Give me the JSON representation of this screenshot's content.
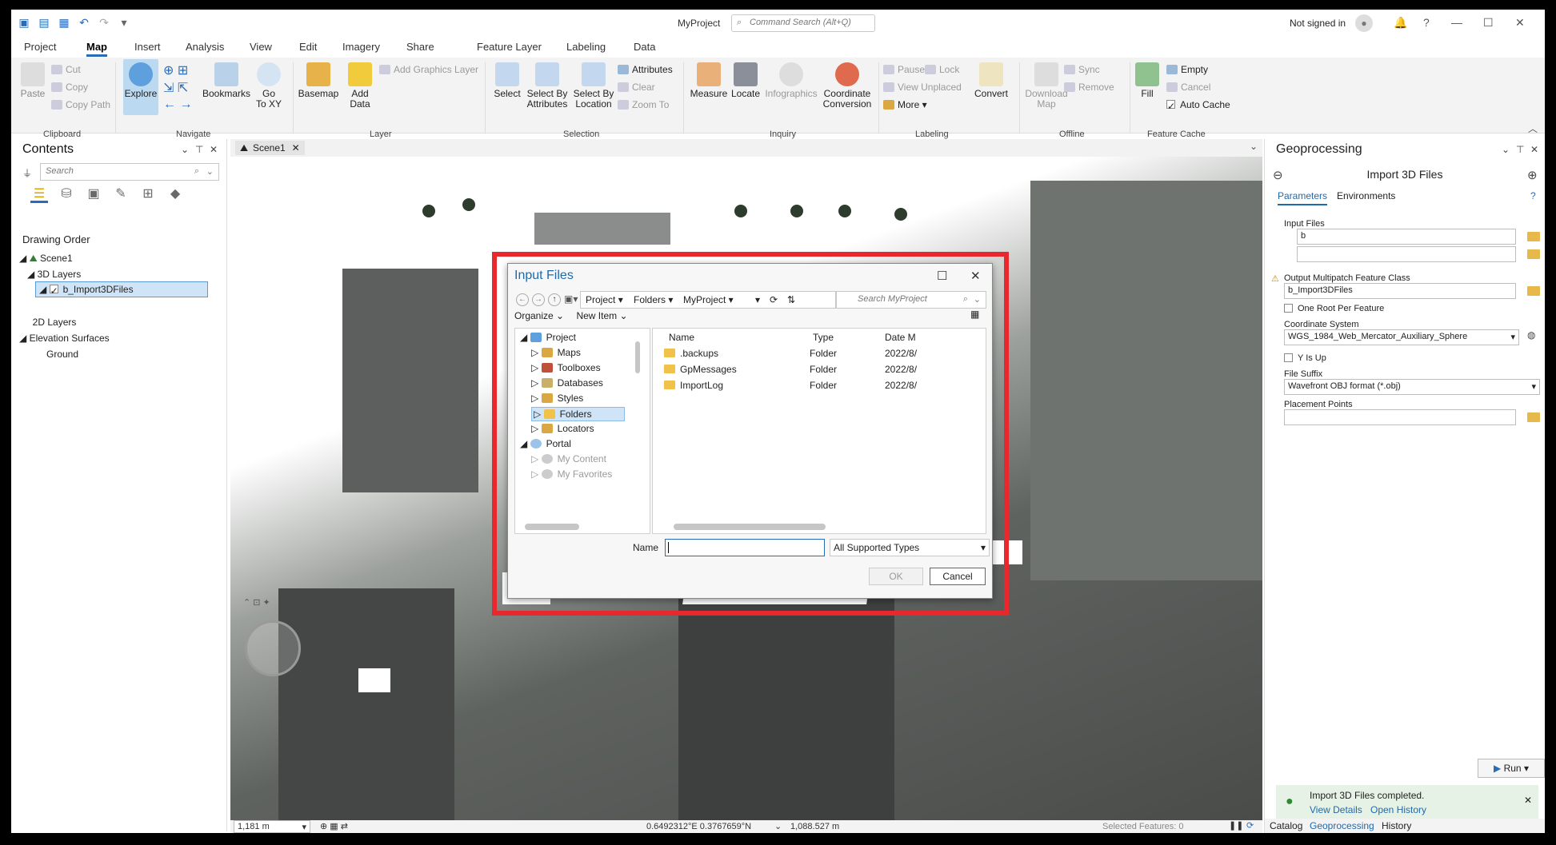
{
  "app": {
    "title": "MyProject",
    "command_search": "Command Search (Alt+Q)",
    "signin": "Not signed in"
  },
  "tabs": [
    "Project",
    "Map",
    "Insert",
    "Analysis",
    "View",
    "Edit",
    "Imagery",
    "Share",
    "Feature Layer",
    "Labeling",
    "Data"
  ],
  "ribbon": {
    "paste": "Paste",
    "cut": "Cut",
    "copy": "Copy",
    "copy_path": "Copy Path",
    "clipboard": "Clipboard",
    "explore": "Explore",
    "bookmarks": "Bookmarks",
    "goto_xy_1": "Go",
    "goto_xy_2": "To XY",
    "navigate": "Navigate",
    "basemap": "Basemap",
    "add_data_1": "Add",
    "add_data_2": "Data",
    "add_graphics": "Add Graphics Layer",
    "layer": "Layer",
    "select": "Select",
    "sel_attr_1": "Select By",
    "sel_attr_2": "Attributes",
    "sel_loc_1": "Select By",
    "sel_loc_2": "Location",
    "attributes": "Attributes",
    "clear": "Clear",
    "zoom_to": "Zoom To",
    "selection": "Selection",
    "measure": "Measure",
    "locate": "Locate",
    "infographics": "Infographics",
    "coord_1": "Coordinate",
    "coord_2": "Conversion",
    "inquiry": "Inquiry",
    "pause": "Pause",
    "lock": "Lock",
    "view_unplaced": "View Unplaced",
    "more": "More",
    "convert": "Convert",
    "labeling": "Labeling",
    "download_1": "Download",
    "download_2": "Map",
    "sync": "Sync",
    "remove": "Remove",
    "offline": "Offline",
    "fill": "Fill",
    "empty": "Empty",
    "cancel": "Cancel",
    "auto_cache": "Auto Cache",
    "feature_cache": "Feature Cache"
  },
  "contents": {
    "title": "Contents",
    "search_placeholder": "Search",
    "drawing_order": "Drawing Order",
    "scene": "Scene1",
    "layers3d": "3D Layers",
    "layer": "b_Import3DFiles",
    "layers2d": "2D Layers",
    "elevation": "Elevation Surfaces",
    "ground": "Ground"
  },
  "view": {
    "tab": "Scene1",
    "scale": "1,181 m",
    "coords": "0.6492312°E 0.3767659°N",
    "elev": "1,088.527 m",
    "selected": "Selected Features: 0"
  },
  "dialog": {
    "title": "Input Files",
    "crumbs": [
      "Project",
      "Folders",
      "MyProject"
    ],
    "search_placeholder": "Search MyProject",
    "organize": "Organize",
    "new_item": "New Item",
    "nav": [
      {
        "label": "Project",
        "level": 0
      },
      {
        "label": "Maps",
        "level": 1
      },
      {
        "label": "Toolboxes",
        "level": 1
      },
      {
        "label": "Databases",
        "level": 1
      },
      {
        "label": "Styles",
        "level": 1
      },
      {
        "label": "Folders",
        "level": 1
      },
      {
        "label": "Locators",
        "level": 1
      },
      {
        "label": "Portal",
        "level": 0
      },
      {
        "label": "My Content",
        "level": 1
      },
      {
        "label": "My Favorites",
        "level": 1
      }
    ],
    "columns": [
      "Name",
      "Type",
      "Date M"
    ],
    "rows": [
      {
        "name": ".backups",
        "type": "Folder",
        "date": "2022/8/"
      },
      {
        "name": "GpMessages",
        "type": "Folder",
        "date": "2022/8/"
      },
      {
        "name": "ImportLog",
        "type": "Folder",
        "date": "2022/8/"
      }
    ],
    "name_label": "Name",
    "name_value": "",
    "file_type": "All Supported Types",
    "ok": "OK",
    "cancel": "Cancel"
  },
  "gp": {
    "title": "Geoprocessing",
    "tool": "Import 3D Files",
    "tab_params": "Parameters",
    "tab_env": "Environments",
    "input_files": "Input Files",
    "input_value": "b",
    "output_label": "Output Multipatch Feature Class",
    "output_value": "b_Import3DFiles",
    "one_root": "One Root Per Feature",
    "coord_label": "Coordinate System",
    "coord_value": "WGS_1984_Web_Mercator_Auxiliary_Sphere",
    "y_up": "Y Is Up",
    "suffix_label": "File Suffix",
    "suffix_value": "Wavefront OBJ format (*.obj)",
    "placement": "Placement Points",
    "run": "Run",
    "notif": "Import 3D Files completed.",
    "view_details": "View Details",
    "open_history": "Open History",
    "bottom": [
      "Catalog",
      "Geoprocessing",
      "History"
    ]
  }
}
